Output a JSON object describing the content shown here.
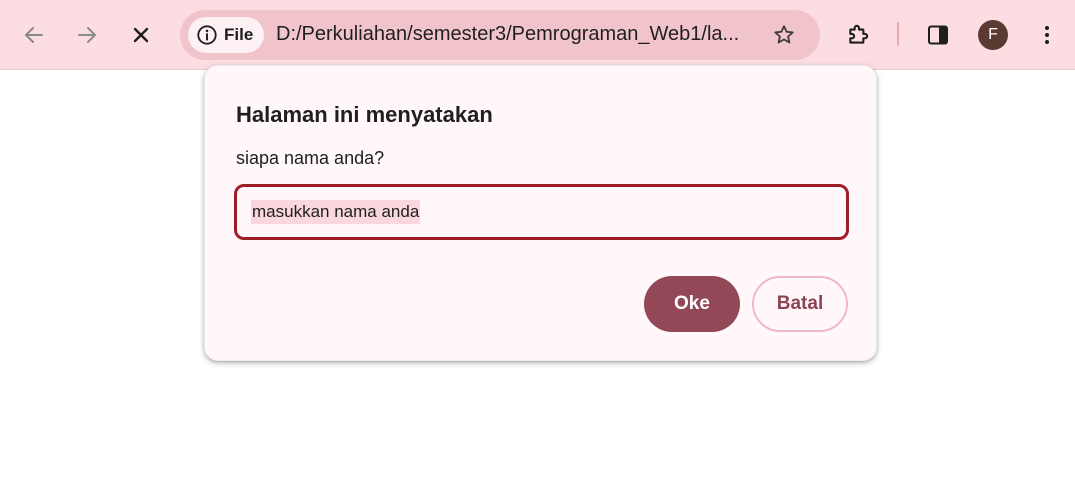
{
  "browser": {
    "site_chip_label": "File",
    "url": "D:/Perkuliahan/semester3/Pemrograman_Web1/la...",
    "profile_initial": "F",
    "icons": {
      "back": "arrow-left-icon",
      "forward": "arrow-right-icon",
      "stop": "close-icon",
      "site_info": "info-icon",
      "bookmark": "star-icon",
      "extensions": "puzzle-icon",
      "side_panel": "side-panel-icon",
      "menu": "kebab-menu-icon"
    }
  },
  "dialog": {
    "title": "Halaman ini menyatakan",
    "message": "siapa nama anda?",
    "input_value": "masukkan nama anda",
    "ok_label": "Oke",
    "cancel_label": "Batal"
  },
  "colors": {
    "toolbar_bg": "#fcdde2",
    "omnibox_bg": "#f1c4cb",
    "accent": "#934858",
    "input_border": "#9f1c2a",
    "avatar_bg": "#5b3a33"
  }
}
